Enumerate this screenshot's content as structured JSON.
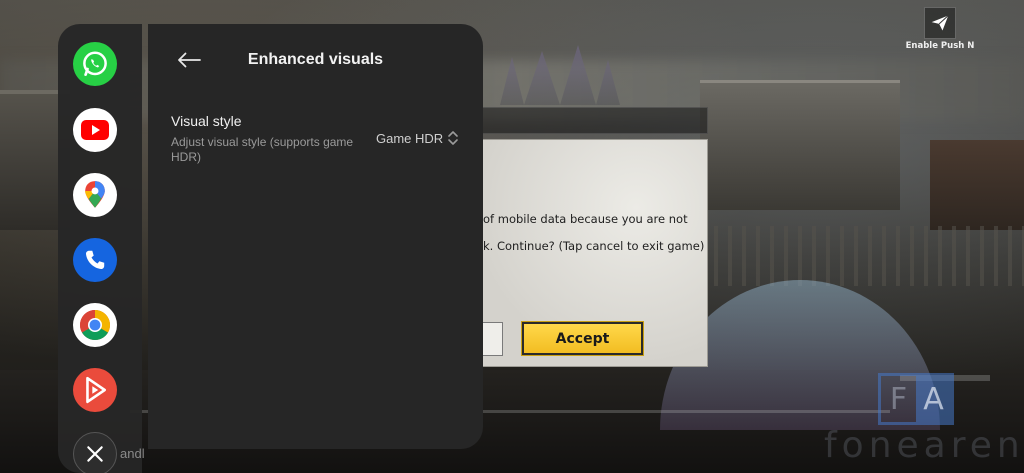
{
  "game": {
    "dialog_line1": "of mobile data because you are not",
    "dialog_line2": "k. Continue? (Tap cancel to exit game)",
    "accept_label": "Accept",
    "push_label": "Enable Push N"
  },
  "dock": {
    "apps": [
      "whatsapp-icon",
      "youtube-icon",
      "maps-icon",
      "phone-icon",
      "chrome-icon",
      "player-icon",
      "x-icon"
    ],
    "partial_label": "andl"
  },
  "panel": {
    "title": "Enhanced visuals",
    "setting": {
      "title": "Visual style",
      "subtitle": "Adjust visual style (supports game HDR)",
      "value": "Game HDR"
    }
  },
  "watermark": {
    "box_left": "F",
    "box_right": "A",
    "text": "fonearena"
  }
}
